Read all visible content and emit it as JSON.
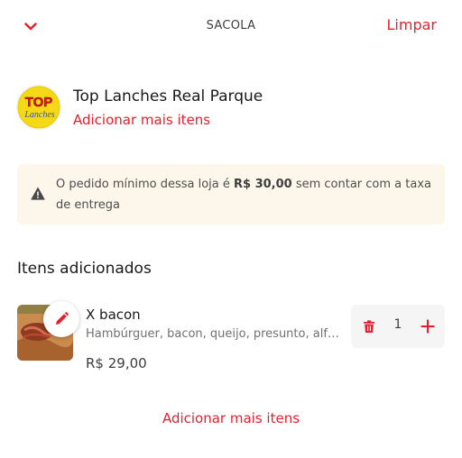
{
  "header": {
    "back_icon": "chevron-down-icon",
    "title": "SACOLA",
    "clear_label": "Limpar"
  },
  "store": {
    "name": "Top Lanches Real Parque",
    "add_more_label": "Adicionar mais itens",
    "logo": {
      "top_text": "TOP",
      "script_text": "Lanches"
    }
  },
  "notice": {
    "icon": "warning-icon",
    "text_before": "O pedido mínimo dessa loja é ",
    "amount": "R$ 30,00",
    "text_after": " sem contar com a taxa de entrega"
  },
  "section_title": "Itens adicionados",
  "item": {
    "name": "X bacon",
    "description": "Hambúrguer, bacon, queijo, presunto, alface, tomate",
    "price": "R$ 29,00",
    "quantity": "1",
    "edit_icon": "pencil-icon",
    "remove_icon": "trash-icon",
    "add_icon": "plus-icon"
  },
  "footer": {
    "add_more_label": "Adicionar mais itens"
  },
  "colors": {
    "accent": "#ea1d2c",
    "notice_bg": "#fdf6ea",
    "stepper_bg": "#f5f5f5",
    "text_dark": "#1a1a1a",
    "text_muted": "#717171"
  }
}
